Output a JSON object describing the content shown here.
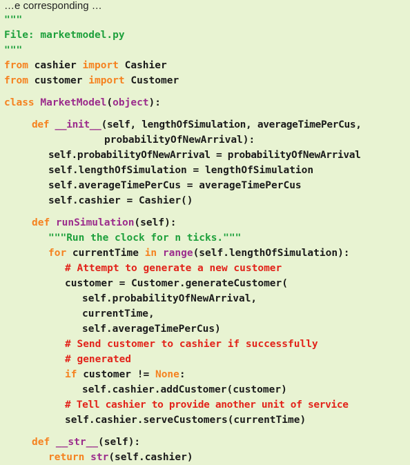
{
  "caption": "…e corresponding …",
  "lines": [
    {
      "t": "\"\"\"",
      "c": "str"
    },
    {
      "t": "File: marketmodel.py",
      "c": "str"
    },
    {
      "t": "\"\"\"",
      "c": "str"
    },
    {
      "kw1": "from",
      "p1": " cashier ",
      "kw2": "import",
      "p2": " Cashier"
    },
    {
      "kw1": "from",
      "p1": " customer ",
      "kw2": "import",
      "p2": " Customer"
    },
    {
      "kw1": "class",
      "fn": " MarketModel",
      "p1": "(",
      "kw2": "object",
      "p2": "):"
    },
    {
      "kw1": "def",
      "fn": " __init__",
      "p1": "(self, lengthOfSimulation, averageTimePerCus,"
    },
    {
      "t": "probabilityOfNewArrival):"
    },
    {
      "t": "self.probabilityOfNewArrival = probabilityOfNewArrival"
    },
    {
      "t": "self.lengthOfSimulation = lengthOfSimulation"
    },
    {
      "t": "self.averageTimePerCus = averageTimePerCus"
    },
    {
      "t": "self.cashier = Cashier()"
    },
    {
      "kw1": "def",
      "fn": " runSimulation",
      "p1": "(self):"
    },
    {
      "t": "\"\"\"Run the clock for n ticks.\"\"\"",
      "c": "str"
    },
    {
      "kw1": "for",
      "p1": " currentTime ",
      "kw2": "in",
      "p2": " ",
      "kw3": "range",
      "p3": "(self.lengthOfSimulation):"
    },
    {
      "t": "# Attempt to generate a new customer",
      "c": "cmt"
    },
    {
      "t": "customer = Customer.generateCustomer("
    },
    {
      "t": "self.probabilityOfNewArrival,"
    },
    {
      "t": "currentTime,"
    },
    {
      "t": "self.averageTimePerCus)"
    },
    {
      "t": "# Send customer to cashier if successfully",
      "c": "cmt"
    },
    {
      "t": "# generated",
      "c": "cmt"
    },
    {
      "kw1": "if",
      "p1": " customer != ",
      "kw2": "None",
      "p2": ":"
    },
    {
      "t": "self.cashier.addCustomer(customer)"
    },
    {
      "t": "# Tell cashier to provide another unit of service",
      "c": "cmt"
    },
    {
      "t": "self.cashier.serveCustomers(currentTime)"
    },
    {
      "kw1": "def",
      "fn": " __str__",
      "p1": "(self):"
    },
    {
      "kw1": "return",
      "p1": " ",
      "kw2": "str",
      "p2": "(self.cashier)"
    }
  ]
}
